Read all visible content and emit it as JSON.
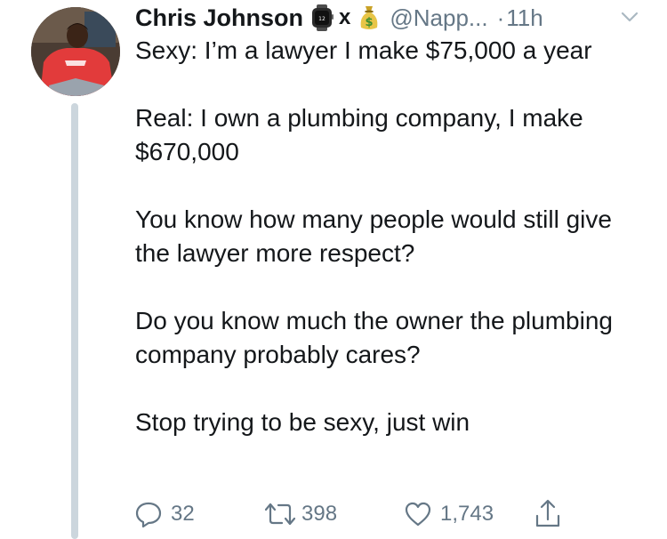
{
  "author": {
    "name": "Chris Johnson",
    "separator": "x",
    "handle": "@Napp...",
    "dot": "·",
    "time": "11h",
    "emojis": [
      "watch-emoji",
      "money-bag-emoji"
    ]
  },
  "tweet": {
    "paragraphs": [
      "Sexy: I’m a lawyer I make $75,000 a year",
      "Real: I own a plumbing company, I make $670,000",
      "You know how many people would still give the lawyer more respect?",
      "Do you know much the owner the plumbing company probably cares?",
      "Stop trying to be sexy, just win"
    ]
  },
  "actions": {
    "replies": "32",
    "retweets": "398",
    "likes": "1,743"
  },
  "colors": {
    "text": "#14171a",
    "secondary": "#657786",
    "thread_line": "#ccd6dd",
    "avatar_shirt": "#e23b3b"
  }
}
